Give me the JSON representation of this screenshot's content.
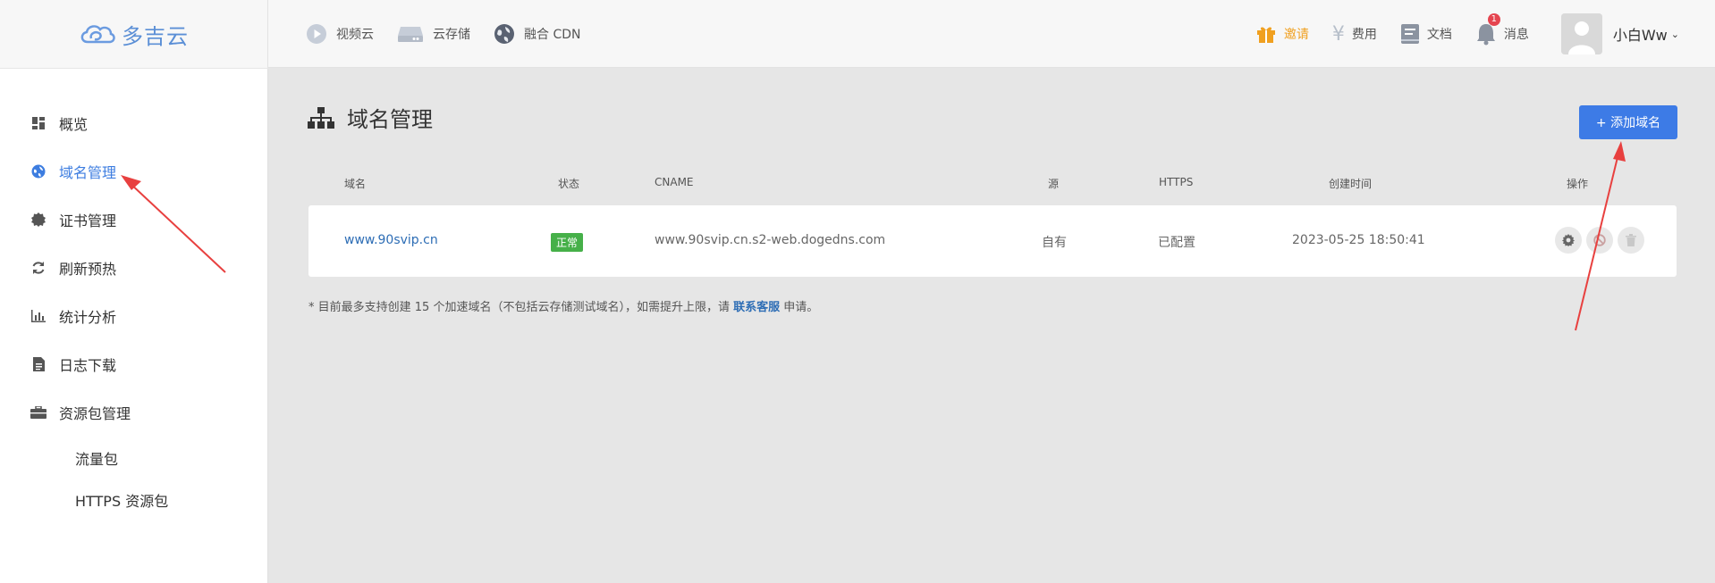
{
  "brand": {
    "name": "多吉云"
  },
  "topnav": [
    {
      "label": "视频云",
      "icon": "play-circle-icon"
    },
    {
      "label": "云存储",
      "icon": "storage-icon"
    },
    {
      "label": "融合 CDN",
      "icon": "globe-icon"
    }
  ],
  "topright": {
    "invite": "邀请",
    "billing": "费用",
    "docs": "文档",
    "messages": "消息",
    "message_count": "1",
    "username": "小白Ww"
  },
  "sidebar": {
    "items": [
      {
        "label": "概览"
      },
      {
        "label": "域名管理"
      },
      {
        "label": "证书管理"
      },
      {
        "label": "刷新预热"
      },
      {
        "label": "统计分析"
      },
      {
        "label": "日志下载"
      },
      {
        "label": "资源包管理"
      }
    ],
    "sub_items": [
      {
        "label": "流量包"
      },
      {
        "label": "HTTPS 资源包"
      }
    ]
  },
  "main": {
    "title": "域名管理",
    "add_button": "+ 添加域名",
    "columns": [
      "域名",
      "状态",
      "CNAME",
      "源",
      "HTTPS",
      "创建时间",
      "操作"
    ],
    "rows": [
      {
        "domain": "www.90svip.cn",
        "status": "正常",
        "cname": "www.90svip.cn.s2-web.dogedns.com",
        "source": "自有",
        "https": "已配置",
        "created": "2023-05-25 18:50:41"
      }
    ],
    "note_prefix": "* 目前最多支持创建 15 个加速域名（不包括云存储测试域名），如需提升上限，请",
    "note_link": "联系客服",
    "note_suffix": "申请。"
  },
  "colors": {
    "accent": "#3d7be6",
    "active": "#3d7de0",
    "status_ok": "#46b049",
    "annotation": "#e8403f"
  }
}
